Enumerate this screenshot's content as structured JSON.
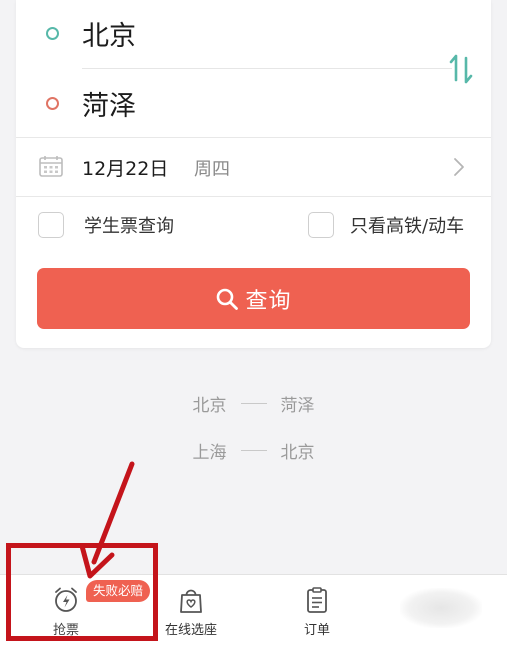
{
  "route": {
    "from_station": "北京",
    "to_station": "菏泽"
  },
  "date": {
    "value": "12月22日",
    "weekday": "周四"
  },
  "options": {
    "student_ticket_label": "学生票查询",
    "high_speed_only_label": "只看高铁/动车"
  },
  "query_button": {
    "label": "查询"
  },
  "history": [
    {
      "from": "北京",
      "to": "菏泽"
    },
    {
      "from": "上海",
      "to": "北京"
    }
  ],
  "tabbar": {
    "grab_tickets": "抢票",
    "grab_badge": "失败必赔",
    "online_seat": "在线选座",
    "orders": "订单"
  },
  "colors": {
    "accent": "#ef6151",
    "from_dot": "#57b8a9",
    "to_dot": "#e07464",
    "annotation": "#c4141b"
  }
}
